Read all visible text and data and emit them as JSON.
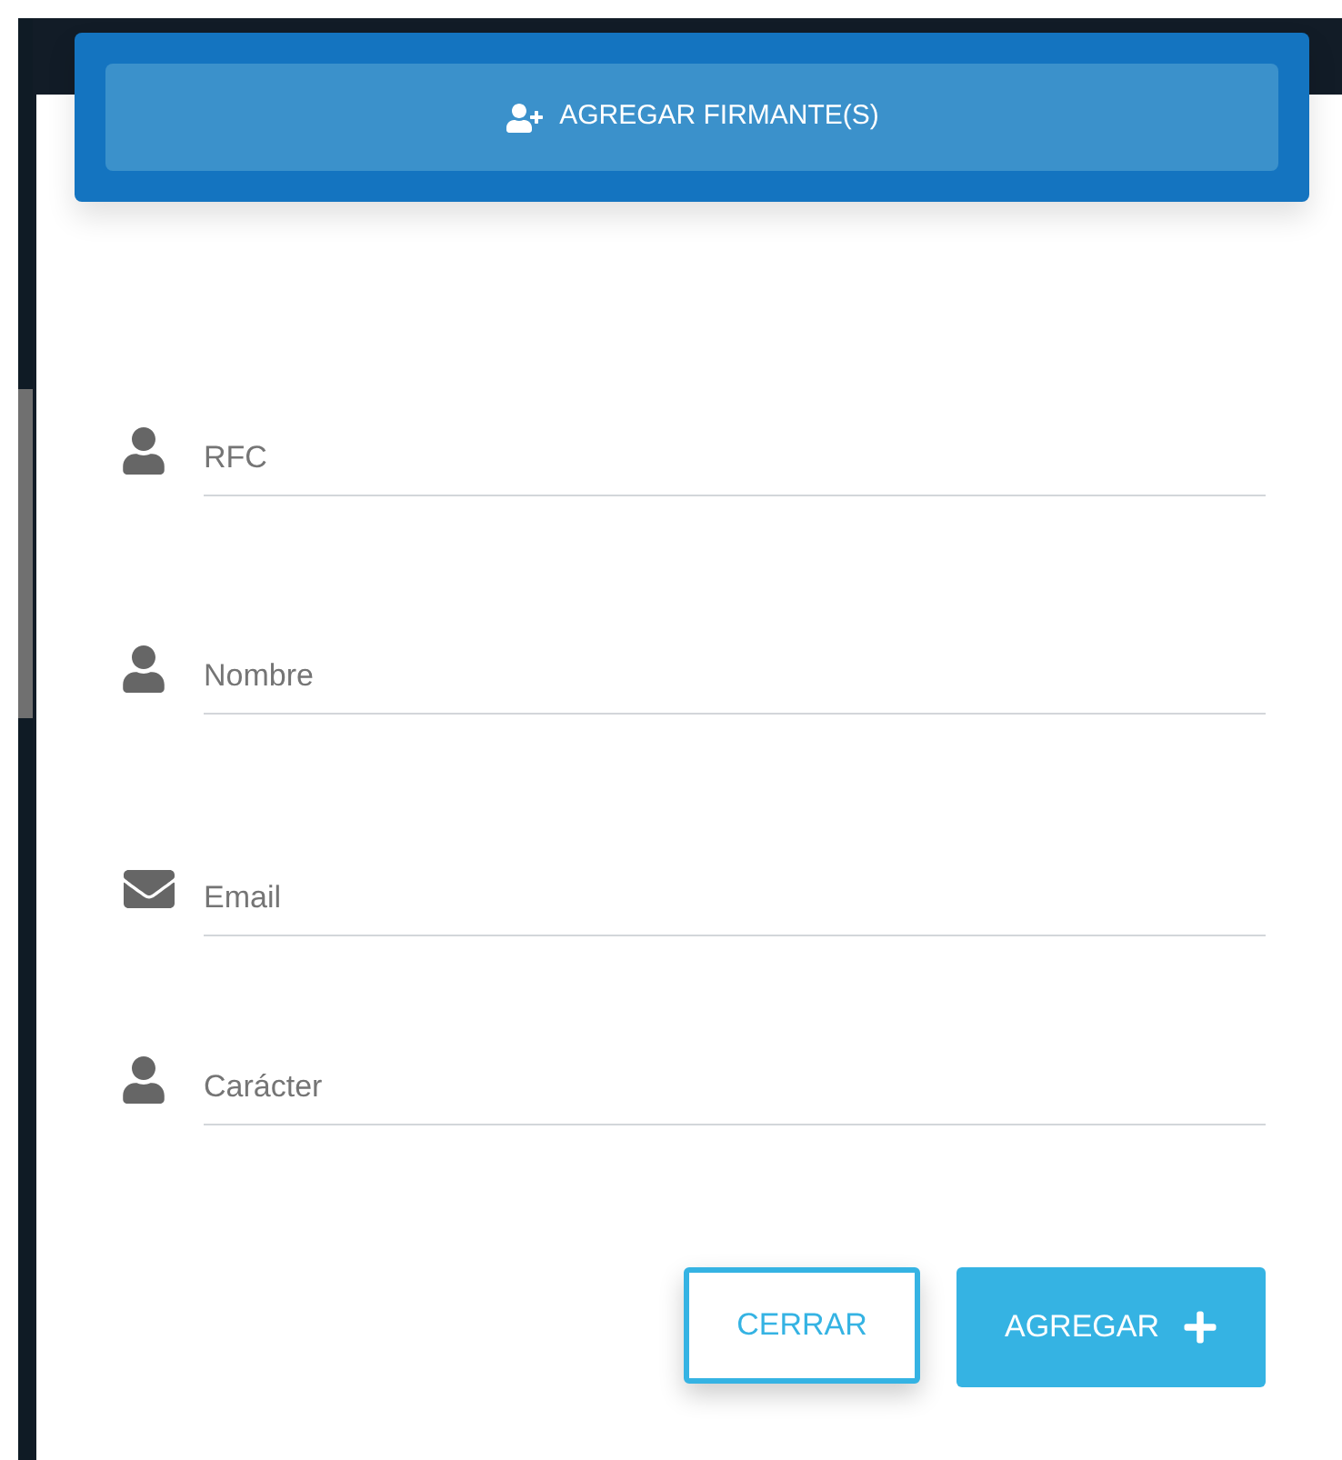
{
  "header_button": {
    "label": "AGREGAR FIRMANTE(S)"
  },
  "fields": [
    {
      "kind": "person",
      "placeholder": "RFC"
    },
    {
      "kind": "person",
      "placeholder": "Nombre"
    },
    {
      "kind": "mail",
      "placeholder": "Email"
    },
    {
      "kind": "person",
      "placeholder": "Carácter"
    }
  ],
  "buttons": [
    {
      "kind": "outline",
      "label": "CERRAR"
    },
    {
      "kind": "primary",
      "label": "AGREGAR"
    }
  ]
}
